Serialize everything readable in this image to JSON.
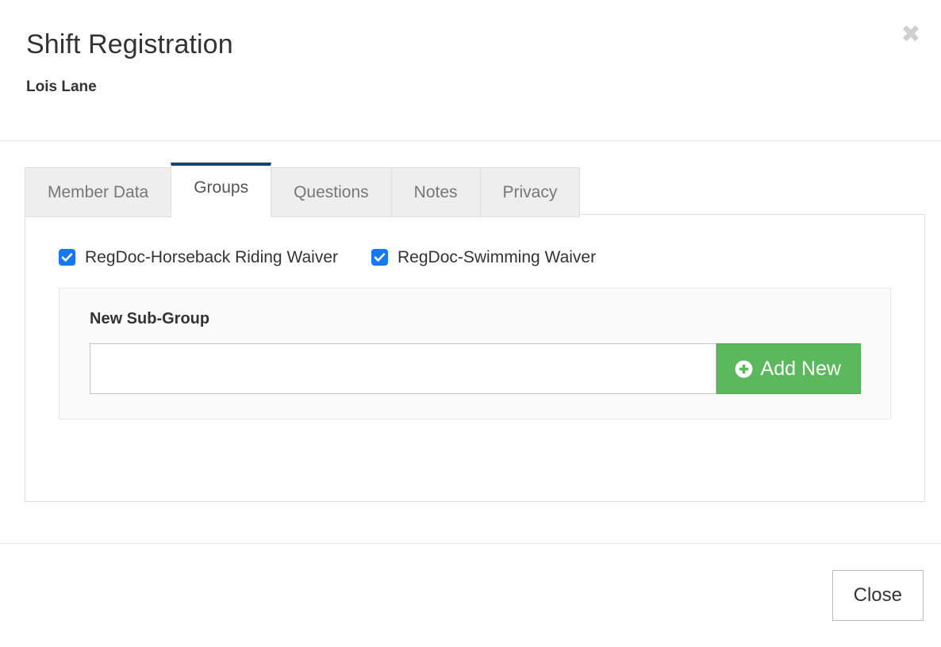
{
  "modal": {
    "title": "Shift Registration",
    "subtitle": "Lois Lane",
    "close_icon_glyph": "✖"
  },
  "tabs": [
    {
      "label": "Member Data",
      "active": false
    },
    {
      "label": "Groups",
      "active": true
    },
    {
      "label": "Questions",
      "active": false
    },
    {
      "label": "Notes",
      "active": false
    },
    {
      "label": "Privacy",
      "active": false
    }
  ],
  "groups_tab": {
    "checkboxes": [
      {
        "label": "RegDoc-Horseback Riding Waiver",
        "checked": true
      },
      {
        "label": "RegDoc-Swimming Waiver",
        "checked": true
      }
    ],
    "subgroup": {
      "title": "New Sub-Group",
      "input_value": "",
      "input_placeholder": "",
      "add_button_label": "Add New",
      "add_button_icon": "plus-circle-icon"
    }
  },
  "footer": {
    "close_label": "Close"
  },
  "colors": {
    "active_tab_accent": "#14466f",
    "checkbox_blue": "#1877f2",
    "add_button_green": "#5cb85c",
    "border_gray": "#dddddd",
    "text_dark": "#333333",
    "tab_inactive_text": "#777777"
  }
}
